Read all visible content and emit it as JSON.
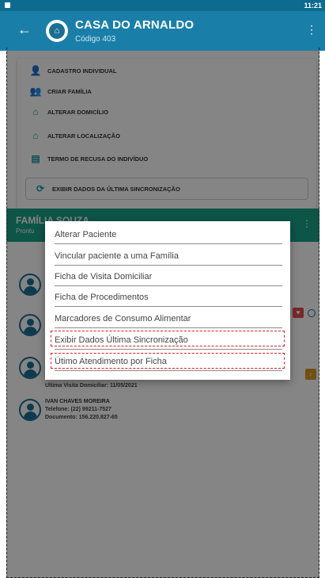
{
  "statusbar": {
    "time": "11:21"
  },
  "appbar": {
    "back_icon": "arrow-left-icon",
    "logo_icon": "house-icon",
    "title": "CASA DO ARNALDO",
    "subtitle": "Código 403",
    "menu_icon": "kebab-icon"
  },
  "actions": [
    {
      "label": "CADASTRO INDIVIDUAL",
      "icon": "person-add-icon"
    },
    {
      "label": "CRIAR FAMÍLIA",
      "icon": "family-add-icon"
    },
    {
      "label": "ALTERAR DOMICÍLIO",
      "icon": "house-edit-icon"
    },
    {
      "label": "ALTERAR LOCALIZAÇÃO",
      "icon": "house-location-icon"
    },
    {
      "label": "TERMO DE RECUSA DO INDIVÍDUO",
      "icon": "document-refuse-icon"
    },
    {
      "label": "EXIBIR DADOS DA ÚLTIMA SINCRONIZAÇÃO",
      "icon": "sync-icon"
    }
  ],
  "family": {
    "name": "FAMÍLIA SOUZA",
    "subtitle": "Prontu"
  },
  "members": [
    {
      "visit": "Ultima Visita Domiciliar: 11/05/2021"
    },
    {
      "name": "IVAN CHAVES MOREIRA",
      "phone": "Telefone: (22) 99211-7527",
      "document": "Documento: 156.220.827-65"
    }
  ],
  "popup": {
    "items": [
      "Alterar Paciente",
      "Vincular paciente a uma Família",
      "Ficha de Visita Domiciliar",
      "Ficha de Procedimentos",
      "Marcadores de Consumo Alimentar",
      "Exibir Dados Última Sincronização",
      "Útimo Atendimento por Ficha"
    ]
  },
  "colors": {
    "appbar": "#1a7fa8",
    "family_bar": "#1aa389",
    "highlight": "#e21b1b"
  }
}
